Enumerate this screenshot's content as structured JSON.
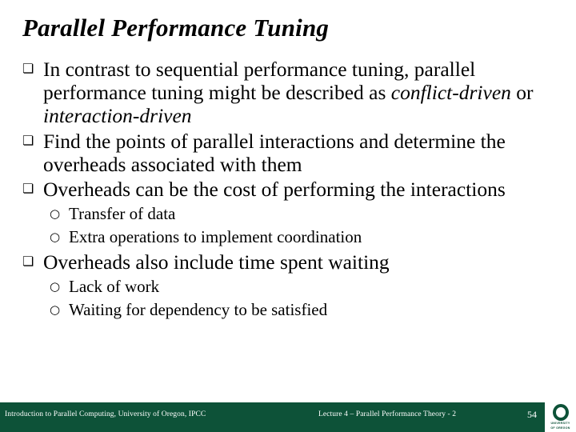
{
  "slide": {
    "title": "Parallel Performance Tuning",
    "bullet_marker": "❏",
    "sub_bullet_marker": "○",
    "bullets": [
      {
        "id": "bullet-contrast-tuning",
        "segments": [
          {
            "text": "In contrast to sequential performance tuning, parallel performance tuning might be described as ",
            "italic": false
          },
          {
            "text": "conflict-driven",
            "italic": true
          },
          {
            "text": " or ",
            "italic": false
          },
          {
            "text": "interaction-driven",
            "italic": true
          }
        ]
      },
      {
        "id": "bullet-find-points",
        "segments": [
          {
            "text": "Find the points of parallel interactions and determine the overheads associated with them",
            "italic": false
          }
        ]
      },
      {
        "id": "bullet-overheads-cost",
        "segments": [
          {
            "text": "Overheads can be the cost of performing the interactions",
            "italic": false
          }
        ],
        "sub_bullets": [
          "Transfer of data",
          "Extra operations to implement coordination"
        ]
      },
      {
        "id": "bullet-overheads-waiting",
        "segments": [
          {
            "text": "Overheads also include time spent waiting",
            "italic": false
          }
        ],
        "sub_bullets": [
          "Lack of work",
          "Waiting for dependency to be satisfied"
        ]
      }
    ]
  },
  "footer": {
    "left_text": "Introduction to Parallel Computing, University of Oregon, IPCC",
    "center_text": "Lecture 4 – Parallel Performance Theory - 2",
    "page_number": "54",
    "bar_color": "#0d5238",
    "logo": {
      "letter": "O",
      "caption_line1": "UNIVERSITY",
      "caption_line2": "OF OREGON",
      "color": "#0d5238"
    }
  }
}
